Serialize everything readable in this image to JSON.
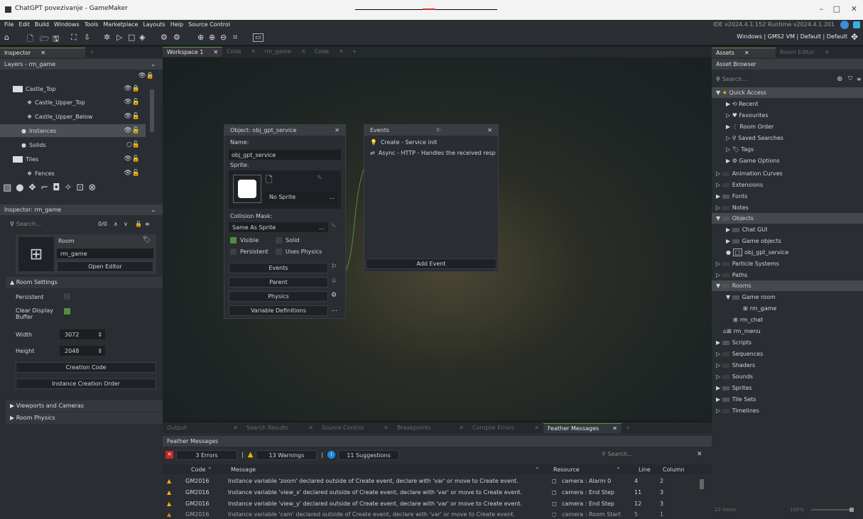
{
  "window": {
    "title": "ChatGPT povezivanje - GameMaker",
    "minimize": "–",
    "maximize": "□",
    "close": "✕"
  },
  "menu": [
    "File",
    "Edit",
    "Build",
    "Windows",
    "Tools",
    "Marketplace",
    "Layouts",
    "Help",
    "Source Control"
  ],
  "ide_version": "IDE v2024.4.1.152 Runtime v2024.4.1.201",
  "target": "Windows | GMS2 VM | Default | Default",
  "left": {
    "tabs": [
      {
        "label": "Inspector",
        "close": "✕"
      },
      {
        "label": "+"
      }
    ],
    "layers_header": "Layers - rm_game",
    "layers": [
      {
        "name": "Castle_Top",
        "icon": "folder-icon",
        "eye": "👁🔒"
      },
      {
        "name": "Castle_Upper_Top",
        "icon": "tile-icon",
        "eye": "👁🔓"
      },
      {
        "name": "Castle_Upper_Below",
        "icon": "tile-icon",
        "eye": "👁🔓"
      },
      {
        "name": "Instances",
        "icon": "instance-icon",
        "eye": "👁🔓"
      },
      {
        "name": "Solids",
        "icon": "instance-icon",
        "eye": "○🔓"
      },
      {
        "name": "Tiles",
        "icon": "folder-icon",
        "eye": "👁🔓"
      },
      {
        "name": "Fences",
        "icon": "tile-icon",
        "eye": "👁🔓"
      }
    ],
    "inspector_header": "Inspector: rm_game",
    "search_placeholder": "Search...",
    "search_count": "0/0",
    "room_label": "Room",
    "room_name": "rm_game",
    "open_editor": "Open Editor",
    "room_settings": "Room Settings",
    "persistent": "Persistent",
    "clear_display": "Clear Display Buffer",
    "width_label": "Width",
    "width": "3072",
    "height_label": "Height",
    "height": "2048",
    "creation_code": "Creation Code",
    "instance_order": "Instance Creation Order",
    "viewports": "Viewports and Cameras",
    "physics": "Room Physics"
  },
  "center": {
    "tabs": [
      {
        "label": "Workspace 1"
      },
      {
        "label": "Code"
      },
      {
        "label": "rm_game"
      },
      {
        "label": "Code"
      }
    ],
    "obj": {
      "title": "Object: obj_gpt_service",
      "name_label": "Name:",
      "name": "obj_gpt_service",
      "sprite_label": "Sprite:",
      "sprite": "No Sprite",
      "mask_label": "Collision Mask:",
      "mask": "Same As Sprite",
      "visible": "Visible",
      "solid": "Solid",
      "persistent": "Persistent",
      "uses_physics": "Uses Physics",
      "events_btn": "Events",
      "parent_btn": "Parent",
      "physics_btn": "Physics",
      "vardef_btn": "Variable Definitions"
    },
    "events": {
      "title": "Events",
      "items": [
        {
          "label": "Create - Service init"
        },
        {
          "label": "Async - HTTP - Handles the received resp"
        }
      ],
      "add": "Add Event"
    }
  },
  "right": {
    "tabs": [
      {
        "label": "Assets"
      },
      {
        "label": "Room Editor"
      }
    ],
    "browser": "Asset Browser",
    "search_placeholder": "Search...",
    "quick_access": "Quick Access",
    "qa": [
      "Recent",
      "Favourites",
      "Room Order",
      "Saved Searches",
      "Tags",
      "Game Options"
    ],
    "groups": [
      "Animation Curves",
      "Extensions",
      "Fonts",
      "Notes",
      "Objects",
      "Chat GUI",
      "Game objects",
      "obj_gpt_service",
      "Particle Systems",
      "Paths",
      "Rooms",
      "Game room",
      "rm_game",
      "rm_chat",
      "rm_menu",
      "Scripts",
      "Sequences",
      "Shaders",
      "Sounds",
      "Sprites",
      "Tile Sets",
      "Timelines"
    ],
    "items_count": "22 items",
    "zoom": "100%"
  },
  "bottom": {
    "tabs": [
      "Output",
      "Search Results",
      "Source Control",
      "Breakpoints",
      "Compile Errors",
      "Feather Messages"
    ],
    "title": "Feather Messages",
    "errors": "3 Errors",
    "warnings": "13 Warnings",
    "suggestions": "11 Suggestions",
    "search_placeholder": "Search...",
    "cols": {
      "code": "Code",
      "message": "Message",
      "resource": "Resource",
      "line": "Line",
      "column": "Column"
    },
    "rows": [
      {
        "code": "GM2016",
        "message": "Instance variable 'zoom' declared outside of Create event, declare with 'var' or move to Create event.",
        "resource": "camera : Alarm 0",
        "line": "4",
        "column": "2"
      },
      {
        "code": "GM2016",
        "message": "Instance variable 'view_x' declared outside of Create event, declare with 'var' or move to Create event.",
        "resource": "camera : End Step",
        "line": "11",
        "column": "3"
      },
      {
        "code": "GM2016",
        "message": "Instance variable 'view_y' declared outside of Create event, declare with 'var' or move to Create event.",
        "resource": "camera : End Step",
        "line": "12",
        "column": "3"
      },
      {
        "code": "GM2016",
        "message": "Instance variable 'cam' declared outside of Create event, declare with 'var' or move to Create event.",
        "resource": "camera : Room Start",
        "line": "5",
        "column": "1"
      }
    ]
  }
}
